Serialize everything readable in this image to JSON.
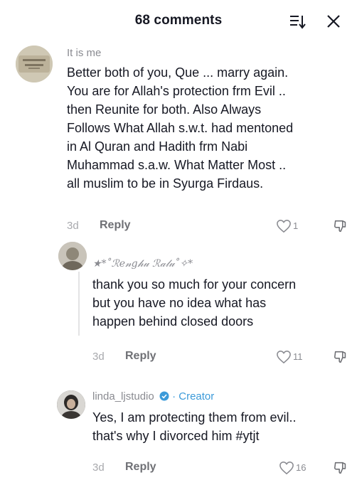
{
  "header": {
    "title": "68 comments",
    "sort_icon": "sort-icon",
    "close_icon": "close-icon"
  },
  "comments": [
    {
      "username": "It is me",
      "text": "Better both of you, Que ... marry again.\nYou are for Allah's protection frm Evil ..\nthen Reunite for both. Also Always\nFollows What Allah s.w.t. had mentoned\nin Al Quran and Hadith frm Nabi\nMuhammad s.a.w. What Matter Most ..\nall muslim to be in Syurga Firdaus.",
      "time": "3d",
      "reply": "Reply",
      "likes": "1"
    },
    {
      "username": "★*˚ℛ𝑒𝓃𝑔𝒽𝓊 ℛ𝒶𝓁𝓊˚✧*",
      "text": "thank you so much for your concern\nbut you have no idea what has\nhappen behind closed doors",
      "time": "3d",
      "reply": "Reply",
      "likes": "11"
    },
    {
      "username": "linda_ljstudio",
      "creator_label": "· Creator",
      "text": "Yes, I am protecting them from evil..\nthat's why I divorced him #ytjt",
      "time": "3d",
      "reply": "Reply",
      "likes": "16"
    }
  ],
  "colors": {
    "creator_accent": "#3b9ad9",
    "muted_text": "#8a8b91",
    "primary_text": "#161823"
  }
}
